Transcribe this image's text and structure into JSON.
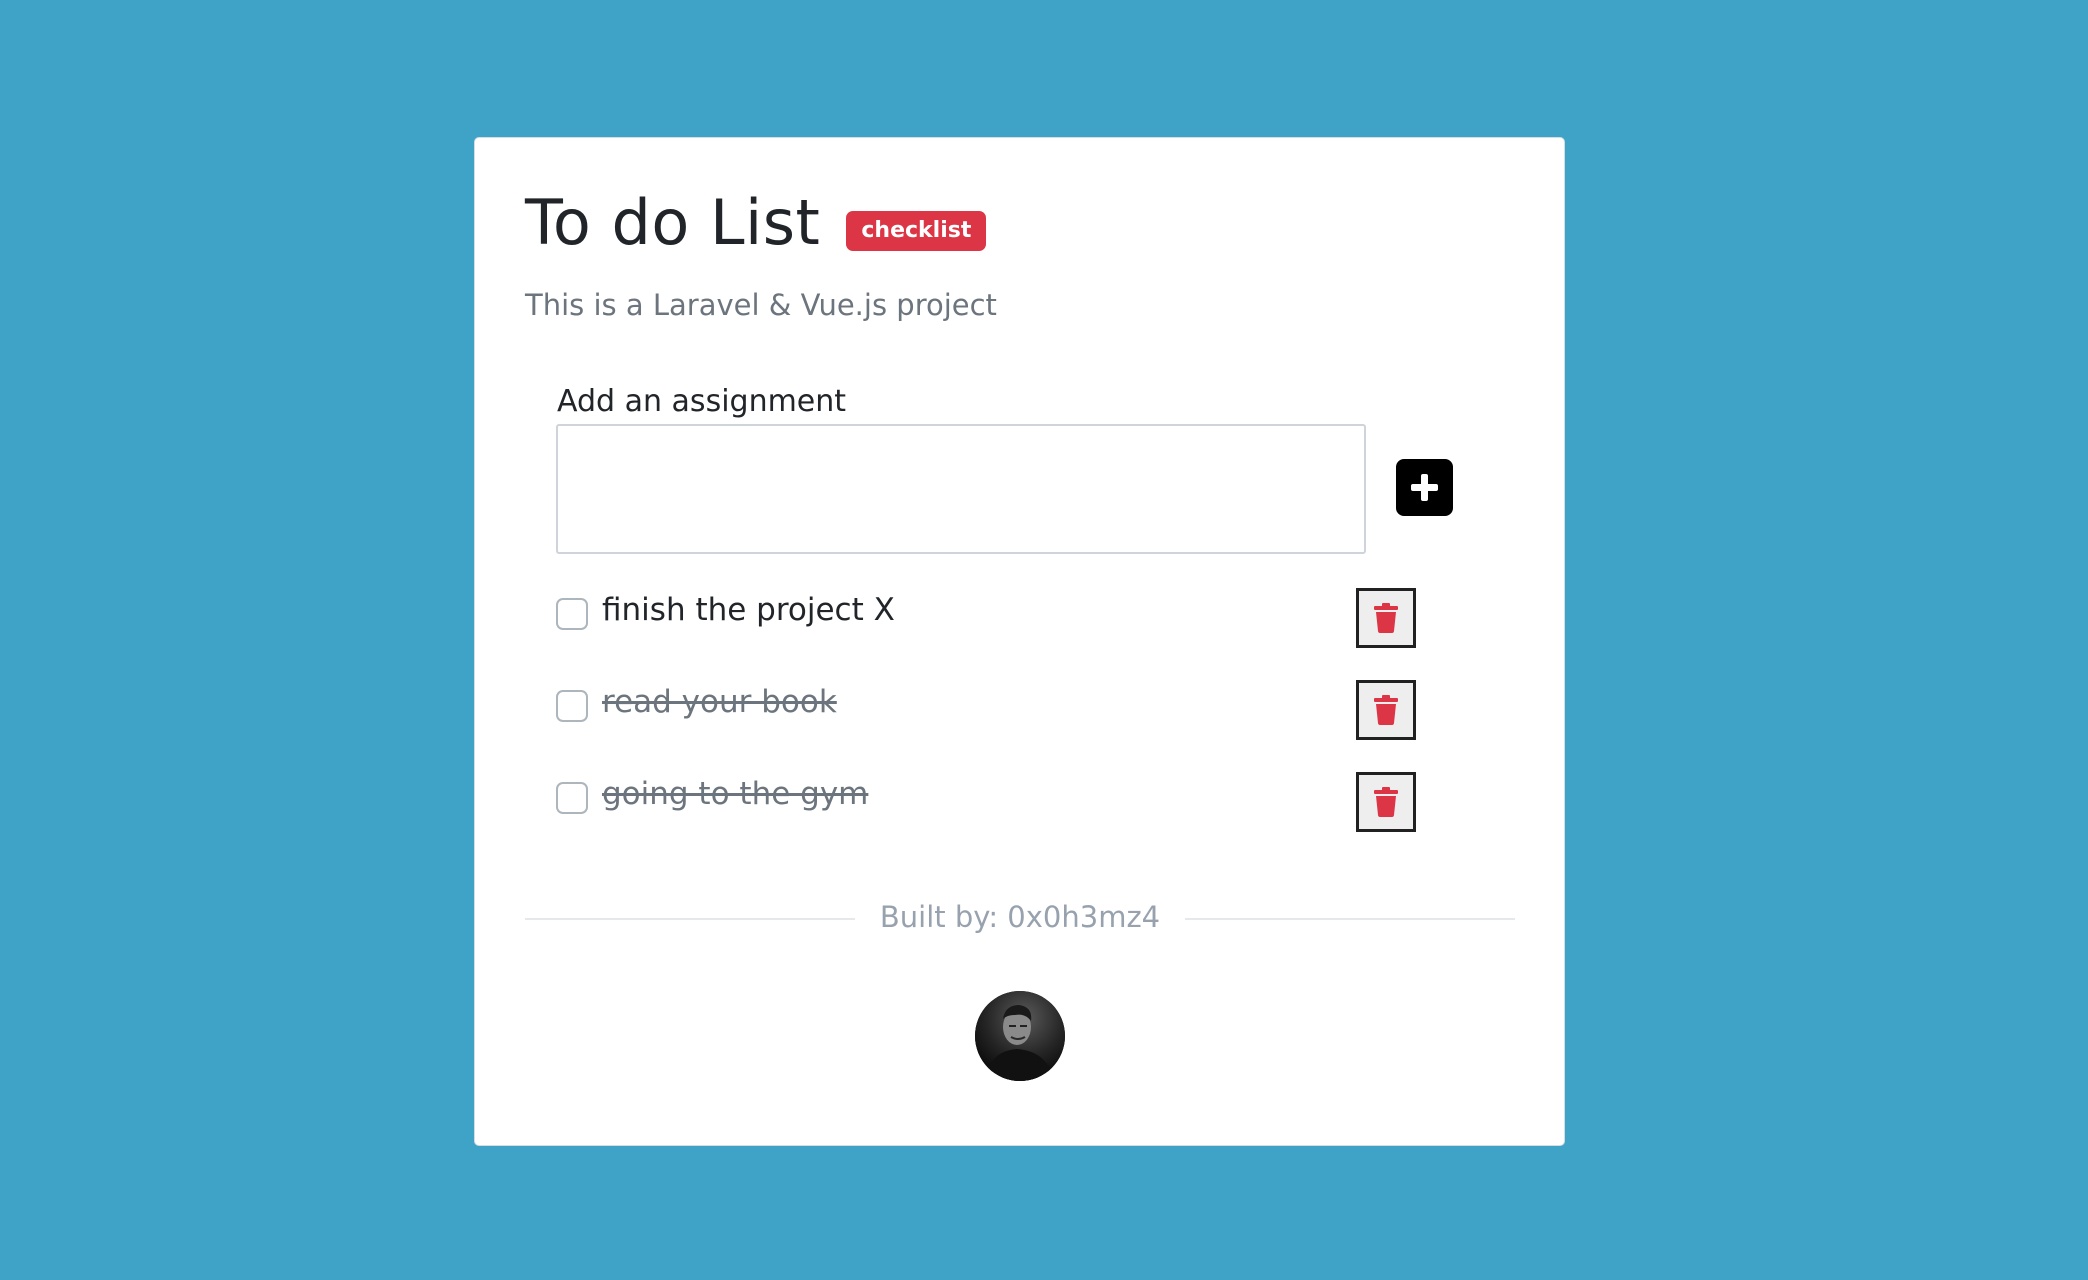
{
  "header": {
    "title": "To do List",
    "badge": "checklist",
    "subtitle": "This is a Laravel & Vue.js project"
  },
  "form": {
    "label": "Add an assignment",
    "input_value": "",
    "input_placeholder": "",
    "add_icon": "plus-icon"
  },
  "tasks": [
    {
      "text": "finish the project X",
      "completed": false
    },
    {
      "text": "read your book",
      "completed": true
    },
    {
      "text": "going to the gym",
      "completed": true
    }
  ],
  "footer": {
    "built_by": "Built by: 0x0h3mz4"
  },
  "colors": {
    "background": "#3fa3c7",
    "badge": "#dc3545",
    "delete_icon": "#dc3545",
    "add_button": "#000000"
  },
  "icons": {
    "delete": "trash-icon",
    "add": "plus-icon"
  }
}
